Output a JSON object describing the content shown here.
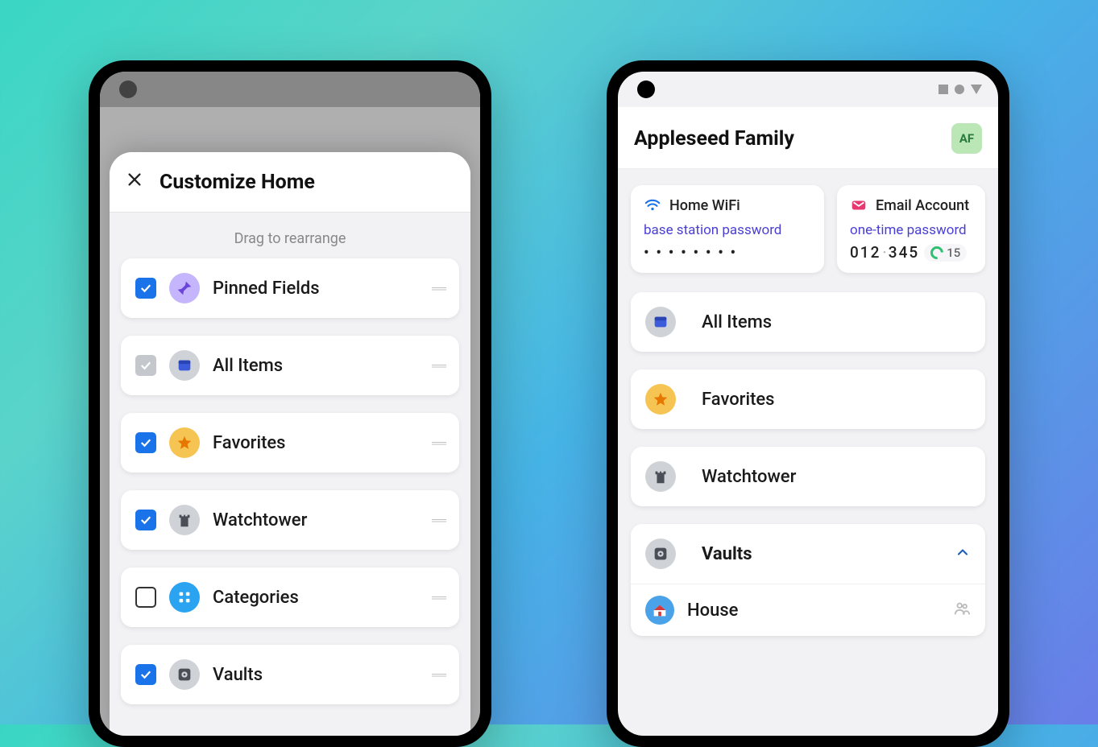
{
  "left": {
    "title": "Customize Home",
    "hint": "Drag to rearrange",
    "rows": [
      {
        "label": "Pinned Fields",
        "state": "checked",
        "icon": "pin"
      },
      {
        "label": "All Items",
        "state": "locked",
        "icon": "allitems"
      },
      {
        "label": "Favorites",
        "state": "checked",
        "icon": "favorite"
      },
      {
        "label": "Watchtower",
        "state": "checked",
        "icon": "tower"
      },
      {
        "label": "Categories",
        "state": "unchecked",
        "icon": "categories"
      },
      {
        "label": "Vaults",
        "state": "checked",
        "icon": "vault"
      }
    ]
  },
  "right": {
    "title": "Appleseed Family",
    "avatar": "AF",
    "pinned": [
      {
        "title": "Home WiFi",
        "subtitle": "base station password",
        "value_masked": "• • • • • • • •",
        "icon": "wifi"
      },
      {
        "title": "Email Account",
        "subtitle": "one-time password",
        "otp_a": "012",
        "otp_b": "345",
        "otp_seconds": "15",
        "icon": "email"
      }
    ],
    "sections": [
      {
        "label": "All Items",
        "icon": "allitems"
      },
      {
        "label": "Favorites",
        "icon": "favorite"
      },
      {
        "label": "Watchtower",
        "icon": "tower"
      }
    ],
    "vaults_header": "Vaults",
    "vaults": [
      {
        "label": "House",
        "icon": "house",
        "shared": true
      }
    ]
  }
}
